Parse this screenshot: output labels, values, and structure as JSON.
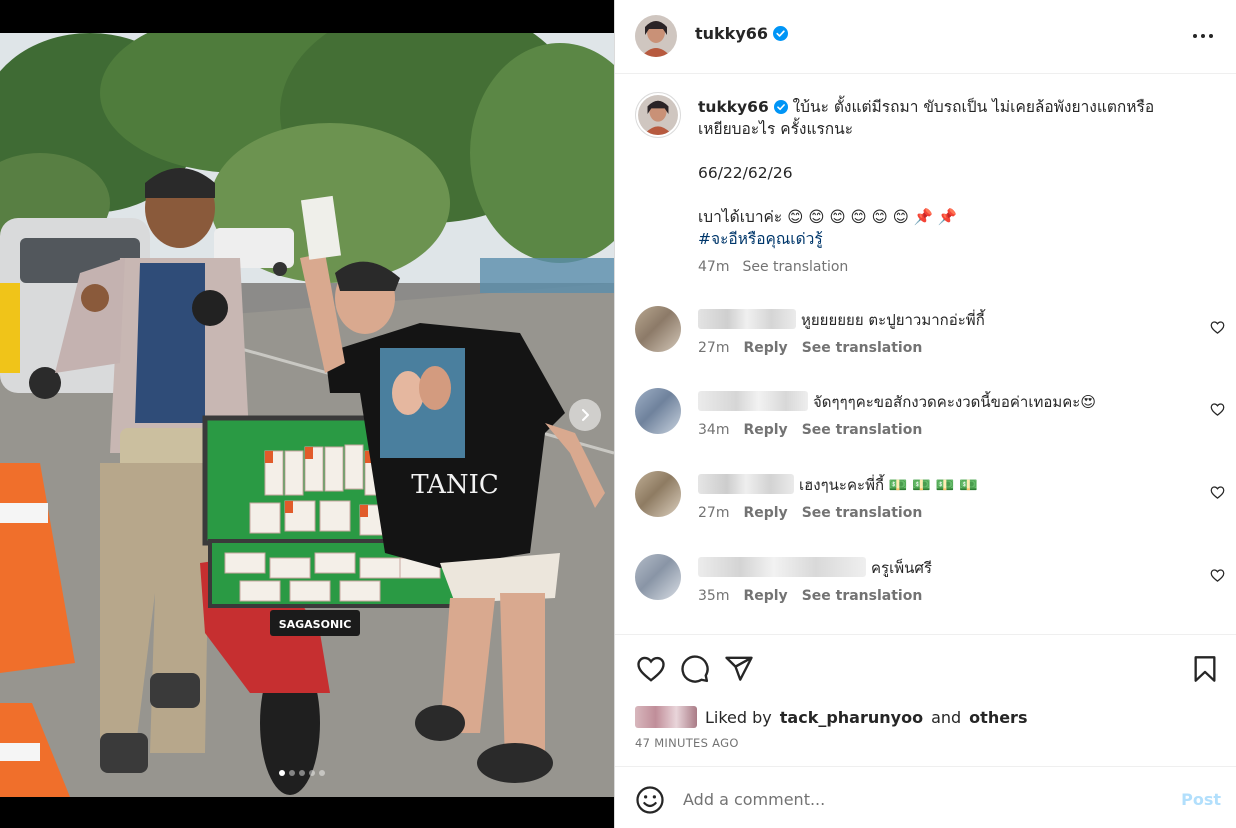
{
  "post": {
    "username": "tukky66",
    "caption_line1": "ใบ้นะ ตั้งแต่มีรถมา ขับรถเป็น ไม่เคยล้อพังยางแตกหรือ",
    "caption_line2": "เหยียบอะไร ครั้งแรกนะ",
    "caption_numbers": "66/22/62/26",
    "caption_line3": "เบาได้เบาค่ะ 😊 😊 😊 😊 😊 😊 📌 📌",
    "hashtag": "#จะอีหรือคุณเด่วรู้",
    "caption_time": "47m",
    "see_translation": "See translation"
  },
  "comments": [
    {
      "text": "หูยยยยยย ตะปูยาวมากอ่ะพี่กี้",
      "time": "27m",
      "reply": "Reply",
      "see_translation": "See translation"
    },
    {
      "text": "จัดๆๆๆคะขอสักงวดคะงวดนี้ขอค่าเทอมคะ😍",
      "time": "34m",
      "reply": "Reply",
      "see_translation": "See translation"
    },
    {
      "text": "เฮงๆนะคะพี่กี้ 💵 💵 💵 💵",
      "time": "27m",
      "reply": "Reply",
      "see_translation": "See translation"
    },
    {
      "text": "ครูเพ็นศรี",
      "time": "35m",
      "reply": "Reply",
      "see_translation": "See translation"
    }
  ],
  "likes": {
    "prefix": "Liked by",
    "user": "tack_pharunyoo",
    "and": "and",
    "others": "others",
    "time_ago": "47 MINUTES AGO"
  },
  "comment_box": {
    "placeholder": "Add a comment...",
    "post_label": "Post"
  },
  "photo": {
    "box_label": "SAGASONIC",
    "shirt_text": "TANIC"
  },
  "carousel": {
    "total": 5,
    "active": 1
  },
  "colors": {
    "verified": "#0095f6",
    "link": "#00376b",
    "secondary": "#737373",
    "post_disabled": "#b2dffc"
  },
  "icons": [
    "verified-badge-icon",
    "more-options-icon",
    "heart-icon",
    "comment-icon",
    "share-icon",
    "bookmark-icon",
    "emoji-icon",
    "chevron-right-icon"
  ]
}
